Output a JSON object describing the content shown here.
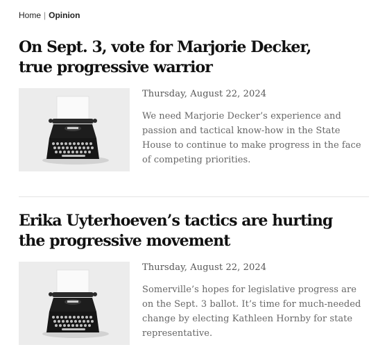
{
  "breadcrumb": {
    "home": "Home",
    "separator": "|",
    "current": "Opinion"
  },
  "articles": [
    {
      "headline": "On Sept. 3, vote for Marjorie Decker, true progressive warrior",
      "date": "Thursday, August 22, 2024",
      "summary": "We need Marjorie Decker’s experience and passion and tactical know-how in the State House to continue to make progress in the face of competing priorities.",
      "thumbnail": "typewriter-image"
    },
    {
      "headline": "Erika Uyterhoeven’s tactics are hurting the progressive movement",
      "date": "Thursday, August 22, 2024",
      "summary": "Somerville’s hopes for legislative progress are on the Sept. 3 ballot. It’s time for much-needed change by electing Kathleen Hornby for state representative.",
      "thumbnail": "typewriter-image"
    }
  ],
  "colors": {
    "headline": "#111111",
    "date": "#555555",
    "summary": "#666666",
    "divider": "#e4e4e4"
  }
}
